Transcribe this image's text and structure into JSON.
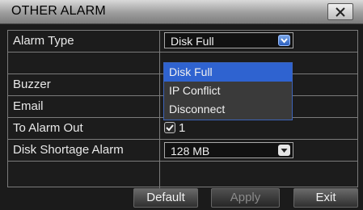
{
  "window": {
    "title": "OTHER ALARM"
  },
  "rows": {
    "alarm_type": {
      "label": "Alarm Type",
      "value": "Disk Full"
    },
    "buzzer": {
      "label": "Buzzer"
    },
    "email": {
      "label": "Email"
    },
    "to_alarm_out": {
      "label": "To Alarm Out",
      "checked": true,
      "value": "1"
    },
    "disk_shortage": {
      "label": "Disk Shortage Alarm",
      "value": "128 MB"
    }
  },
  "dropdown": {
    "options": [
      "Disk Full",
      "IP Conflict",
      "Disconnect"
    ],
    "selected": "Disk Full"
  },
  "buttons": {
    "default": "Default",
    "apply": "Apply",
    "exit": "Exit"
  },
  "colors": {
    "selection": "#2f63d0",
    "border": "#7b7b7b",
    "title_gradient_top": "#d9d9d9"
  },
  "icons": {
    "close": "close-icon",
    "dropdown": "chevron-down-icon",
    "check": "check-icon"
  }
}
